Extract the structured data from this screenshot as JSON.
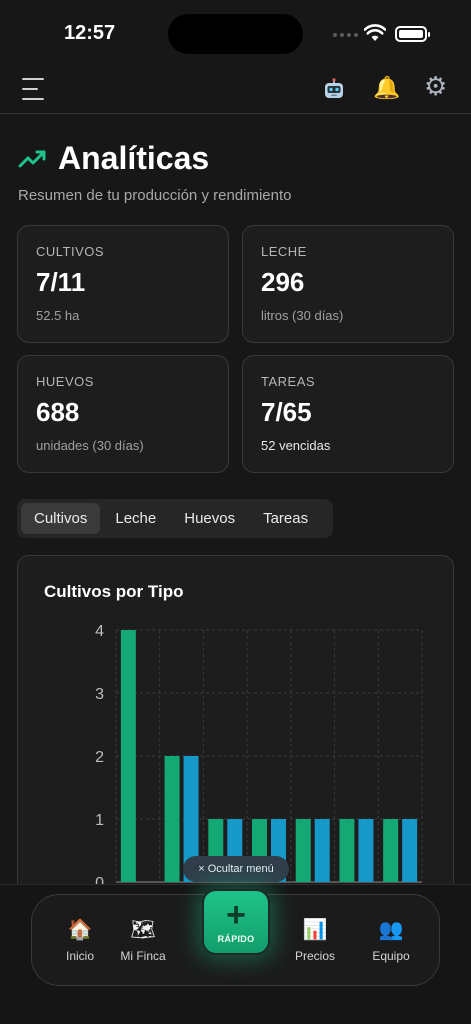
{
  "status": {
    "time": "12:57"
  },
  "header": {
    "title": "Analíticas",
    "subtitle": "Resumen de tu producción y rendimiento"
  },
  "stats": [
    {
      "label": "CULTIVOS",
      "value": "7/11",
      "sub": "52.5 ha"
    },
    {
      "label": "LECHE",
      "value": "296",
      "sub": "litros (30 días)"
    },
    {
      "label": "HUEVOS",
      "value": "688",
      "sub": "unidades (30 días)"
    },
    {
      "label": "TAREAS",
      "value": "7/65",
      "sub": "52 vencidas"
    }
  ],
  "tabs": [
    {
      "label": "Cultivos",
      "active": true
    },
    {
      "label": "Leche",
      "active": false
    },
    {
      "label": "Huevos",
      "active": false
    },
    {
      "label": "Tareas",
      "active": false
    }
  ],
  "chart_data": {
    "type": "bar",
    "title": "Cultivos por Tipo",
    "ylim": [
      0,
      4
    ],
    "y_ticks": [
      "0",
      "1",
      "2",
      "3",
      "4"
    ],
    "grid": true,
    "series": [
      {
        "color": "#13a874",
        "values": [
          4,
          2,
          1,
          1,
          1,
          1,
          1
        ]
      },
      {
        "color": "#1699c9",
        "values": [
          0,
          2,
          1,
          1,
          1,
          1,
          1
        ]
      }
    ]
  },
  "overlay": {
    "hide_menu_label": "× Ocultar menú"
  },
  "bottom_nav": {
    "items": [
      {
        "label": "Inicio",
        "icon": "house-icon"
      },
      {
        "label": "Mi Finca",
        "icon": "map-icon"
      },
      {
        "label": "Precios",
        "icon": "bar-chart-icon"
      },
      {
        "label": "Equipo",
        "icon": "people-icon"
      }
    ],
    "fab": {
      "label": "RÁPIDO",
      "icon": "plus-icon"
    }
  }
}
